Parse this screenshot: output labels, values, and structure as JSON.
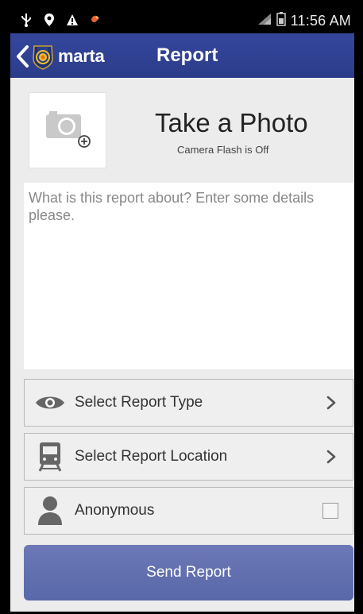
{
  "status_bar": {
    "time": "11:56 AM",
    "icons": [
      "usb-icon",
      "location-pin-icon",
      "warning-icon",
      "notification-icon",
      "signal-icon",
      "battery-icon"
    ]
  },
  "action_bar": {
    "logo_text": "marta",
    "title": "Report",
    "color": "#2f4192"
  },
  "photo": {
    "title": "Take a Photo",
    "flash_status": "Camera Flash is Off"
  },
  "details": {
    "placeholder": "What is this report about? Enter some details please.",
    "value": ""
  },
  "options": {
    "report_type": "Select Report Type",
    "report_location": "Select Report Location",
    "anonymous": "Anonymous",
    "anonymous_checked": false
  },
  "send_button": {
    "label": "Send Report",
    "color": "#6270b0"
  }
}
